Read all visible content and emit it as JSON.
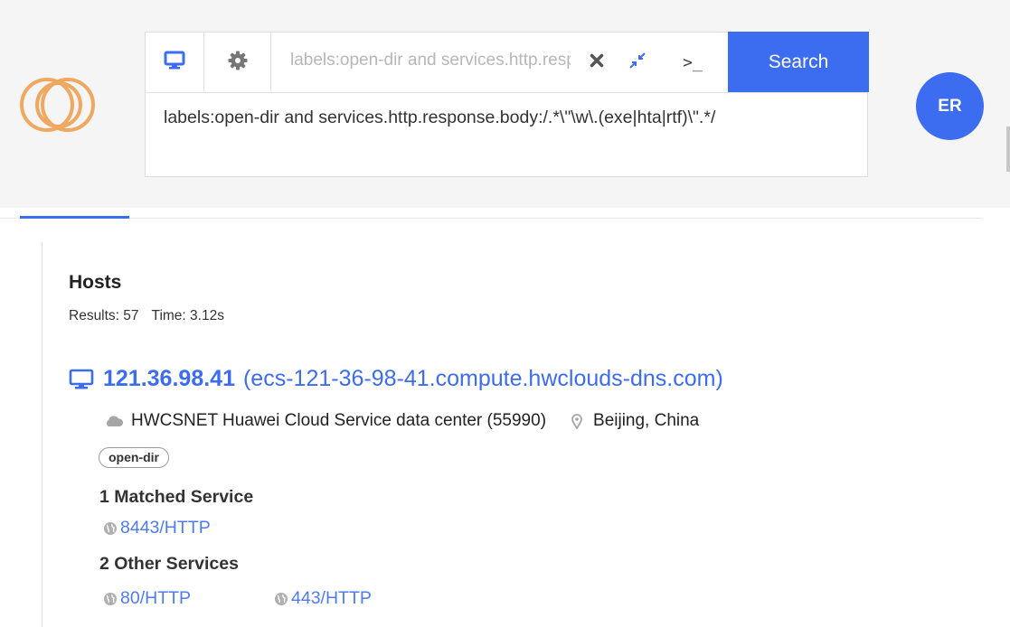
{
  "search": {
    "compact_query": "labels:open-dir and services.http.response.body:/.*\\\"\\w\\.(exe|hta|rtf)\\\".*/",
    "full_query": "labels:open-dir and services.http.response.body:/.*\\\"\\w\\.(exe|hta|rtf)\\\".*/",
    "button_label": "Search",
    "terminal_glyph": ">_",
    "icons": [
      "monitor-icon",
      "gear-icon",
      "close-icon",
      "collapse-icon",
      "terminal-icon"
    ]
  },
  "user": {
    "initials": "ER"
  },
  "colors": {
    "accent": "#3c6df0",
    "logo": "#f0a860",
    "link": "#4d7cf2"
  },
  "results": {
    "title": "Hosts",
    "count_text": "Results: 57",
    "time_text": "Time: 3.12s"
  },
  "host": {
    "ip": "121.36.98.41",
    "hostname": "(ecs-121-36-98-41.compute.hwclouds-dns.com)",
    "network": "HWCSNET Huawei Cloud Service data center (55990)",
    "location": "Beijing, China",
    "tag": "open-dir",
    "matched_label": "1 Matched Service",
    "matched_services": [
      "8443/HTTP"
    ],
    "other_label": "2 Other Services",
    "other_services": [
      "80/HTTP",
      "443/HTTP"
    ]
  }
}
